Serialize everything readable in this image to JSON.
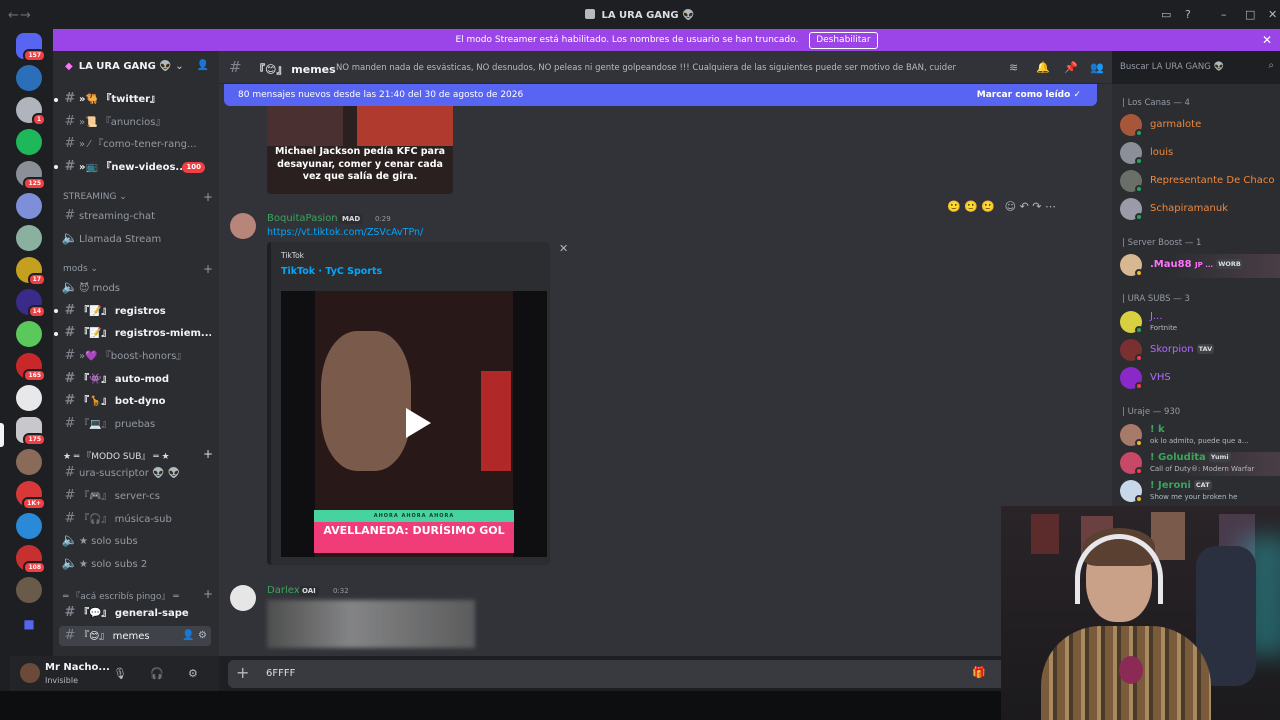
{
  "titlebar": {
    "title": "LA URA GANG 👽"
  },
  "banner": {
    "text": "El modo Streamer está habilitado. Los nombres de usuario se han truncado.",
    "button": "Deshabilitar"
  },
  "rail": {
    "badges": [
      "157",
      "1",
      "125",
      "17",
      "14",
      "165",
      "175",
      "1K+",
      "108"
    ]
  },
  "server": {
    "name": "LA URA GANG 👽"
  },
  "channels": {
    "top": [
      {
        "name": "»🐫 『twitter』"
      },
      {
        "name": "»📜 『anuncios』"
      },
      {
        "name": "» ⁄ 『como-tener-rang..."
      },
      {
        "name": "»📺 『new-videos...",
        "badge": "100"
      }
    ],
    "cat_streaming": "STREAMING",
    "streaming": [
      {
        "name": "streaming-chat"
      },
      {
        "name": "Llamada Stream"
      }
    ],
    "cat_mods": "mods",
    "mods": [
      {
        "name": "😈 mods"
      },
      {
        "name": "『📝』 registros"
      },
      {
        "name": "『📝』 registros-miem..."
      },
      {
        "name": "»💜 『boost-honors』"
      },
      {
        "name": "『👾』 auto-mod"
      },
      {
        "name": "『🦒』 bot-dyno"
      },
      {
        "name": "『💻』 pruebas"
      }
    ],
    "cat_sub": "★ ═ 『MODO SUB』 ═ ★",
    "sub": [
      {
        "name": "ura-suscriptor 👽 👽"
      },
      {
        "name": "『🎮』 server-cs"
      },
      {
        "name": "『🎧』 música-sub"
      },
      {
        "name": "★ solo subs"
      },
      {
        "name": "★ solo subs 2"
      }
    ],
    "cat_general": "═ 『acá escribís pingo』 ═",
    "general": [
      {
        "name": "『💬』 general-sape"
      },
      {
        "name": "『😊』 memes"
      }
    ]
  },
  "user": {
    "name": "Mr Nacho...",
    "status": "Invisible"
  },
  "header": {
    "channel": "『😊』 memes",
    "topic": "NO manden nada de esvásticas, NO desnudos, NO peleas ni gente golpeandose !!! Cualquiera de las siguientes puede ser motivo de BAN, cuiden el stream!",
    "search_placeholder": "Buscar LA URA GANG 👽"
  },
  "chat": {
    "new_messages": "80 mensajes nuevos desde las 21:40 del 30 de agosto de 2026",
    "mark_read": "Marcar como leído",
    "image_caption": "Michael Jackson pedía KFC para desayunar, comer y cenar cada vez que salía de gira.",
    "messages": [
      {
        "author": "BoquitaPasion",
        "tag": "MAD",
        "time": "0:29",
        "link": "https://vt.tiktok.com/ZSVcAvTPn/",
        "embed": {
          "provider": "TikTok",
          "title": "TikTok · TyC Sports",
          "banner_top": "AHORA   AHORA   AHORA",
          "banner_text": "AVELLANEDA: DURÍSIMO GOL"
        }
      },
      {
        "author": "Darlex",
        "tag": "OAI",
        "time": "0:32"
      }
    ],
    "composer_value": "6FFFF"
  },
  "members": {
    "groups": [
      {
        "title": "| Los Canas — 4",
        "items": [
          {
            "name": "garmalote",
            "color": "#f0883e"
          },
          {
            "name": "louis",
            "color": "#f0883e"
          },
          {
            "name": "Representante De Chaco",
            "color": "#f0883e"
          },
          {
            "name": "Schapiramanuk",
            "color": "#f0883e"
          }
        ]
      },
      {
        "title": "| Server Boost — 1",
        "items": [
          {
            "name": ".Mau88",
            "extra": "JP ...",
            "chip": "WORB",
            "color": "#ff73fa"
          }
        ]
      },
      {
        "title": "| URA SUBS — 3",
        "items": [
          {
            "name": "J...",
            "activity": "Fortnite",
            "color": "#b36bff"
          },
          {
            "name": "Skorpion",
            "chip": "TAV",
            "color": "#b36bff"
          },
          {
            "name": "VHS",
            "color": "#b36bff"
          }
        ]
      },
      {
        "title": "| Uraje — 930",
        "items": [
          {
            "name": "! k",
            "activity": "ok lo admito, puede que a...",
            "color": "#3ba55c"
          },
          {
            "name": "! Goludita",
            "chip": "Yumi",
            "activity": "Call of Duty®: Modern Warfar",
            "color": "#3ba55c"
          },
          {
            "name": "! Jeroni",
            "chip": "CAT",
            "activity": "Show me your broken he",
            "color": "#3ba55c"
          }
        ]
      }
    ]
  },
  "colors": {
    "accent": "#5865f2",
    "streamer_banner": "#9b44e8",
    "link": "#00a8fc",
    "badge": "#f23f43"
  }
}
